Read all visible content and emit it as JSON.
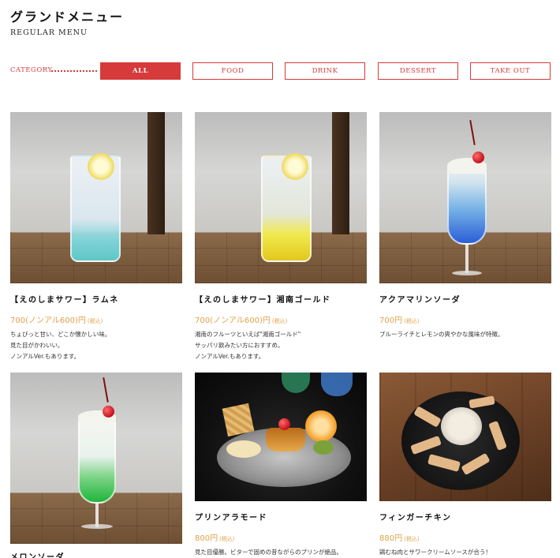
{
  "header": {
    "title": "グランドメニュー",
    "subtitle": "REGULAR MENU"
  },
  "category": {
    "label": "CATEGORY",
    "buttons": [
      "ALL",
      "FOOD",
      "DRINK",
      "DESSERT",
      "TAKE OUT"
    ],
    "active": "ALL"
  },
  "colors": {
    "accent": "#d63a3a",
    "price": "#e0a24a"
  },
  "items": [
    {
      "name": "【えのしまサワー】ラムネ",
      "price": "700(ノンアル600)円",
      "tax": "(税込)",
      "desc": [
        "ちょびっと甘い、どこか懐かしい味。",
        "見た目がかわいい。",
        "ノンアルVer.もあります。"
      ]
    },
    {
      "name": "【えのしまサワー】湘南ゴールド",
      "price": "700(ノンアル600)円",
      "tax": "(税込)",
      "desc": [
        "湘南のフルーツといえば\"湘南ゴールド\"",
        "サッパリ飲みたい方におすすめ。",
        "ノンアルVer.もあります。"
      ]
    },
    {
      "name": "アクアマリンソーダ",
      "price": "700円",
      "tax": "(税込)",
      "desc": [
        "ブルーライチとレモンの爽やかな風味が特徴。"
      ]
    },
    {
      "name": "メロンソーダ",
      "price": "",
      "tax": "",
      "desc": []
    },
    {
      "name": "プリンアラモード",
      "price": "800円",
      "tax": "(税込)",
      "desc": [
        "見た目優勝。ビターで固めの昔ながらのプリンが絶品。"
      ]
    },
    {
      "name": "フィンガーチキン",
      "price": "880円",
      "tax": "(税込)",
      "desc": [
        "鶏むね肉とサワークリームソースが合う！"
      ]
    }
  ]
}
